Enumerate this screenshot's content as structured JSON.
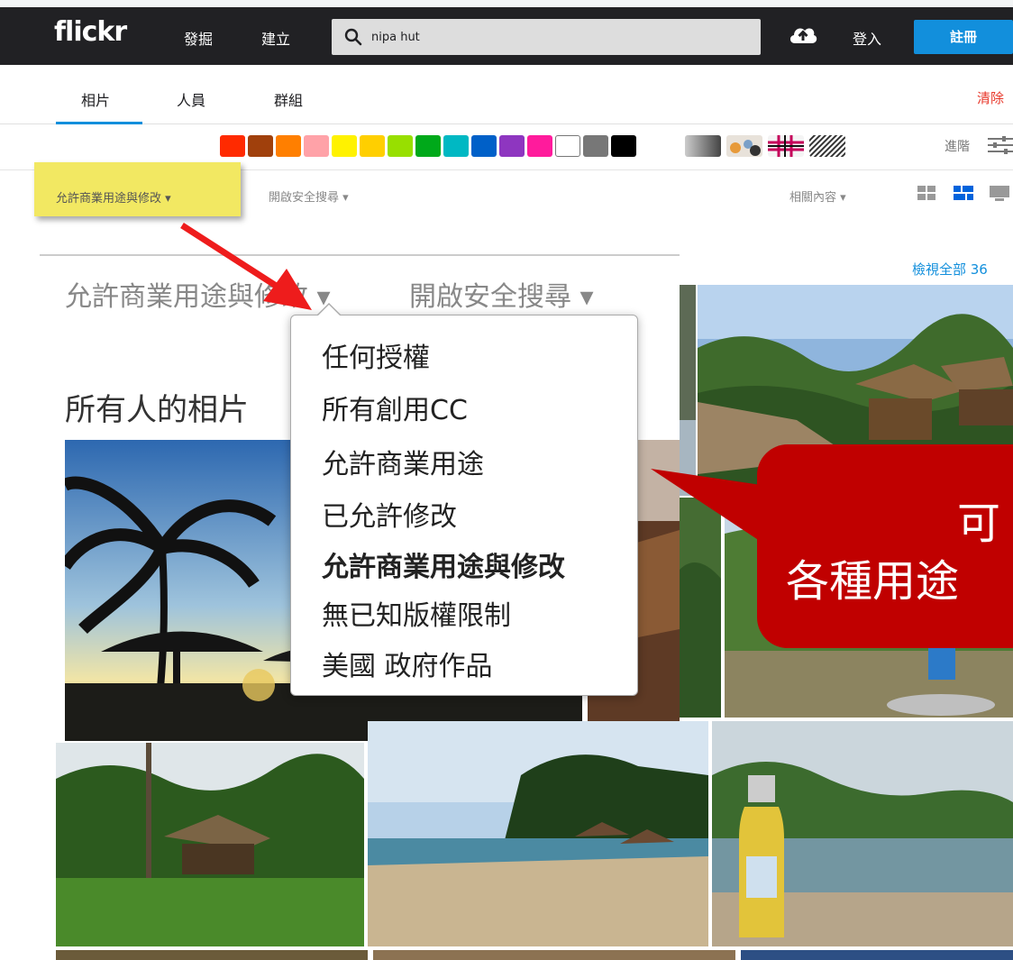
{
  "header": {
    "logo": "flickr",
    "nav": [
      "發掘",
      "建立"
    ],
    "search_value": "nipa hut",
    "login": "登入",
    "signup": "註冊"
  },
  "tabs": {
    "items": [
      "相片",
      "人員",
      "群組"
    ],
    "clear": "清除"
  },
  "colors": {
    "swatches": [
      "#ff2a00",
      "#a0400c",
      "#ff7f00",
      "#ffa2a8",
      "#fff200",
      "#ffcf00",
      "#98df00",
      "#00a91a",
      "#00b8c3",
      "#0060c8",
      "#8e36c0",
      "#ff1b9c",
      "#ffffff",
      "#777777",
      "#000000"
    ],
    "advanced": "進階"
  },
  "filters": {
    "license": "允許商業用途與修改 ▾",
    "safe_search": "開啟安全搜尋 ▾",
    "related": "相關內容 ▾"
  },
  "zoom": {
    "view_all": "檢視全部 36",
    "license_big": "允許商業用途與修改 ▾",
    "safe_big": "開啟安全搜尋 ▾",
    "heading": "所有人的相片"
  },
  "dropdown": {
    "items": [
      "任何授權",
      "所有創用CC",
      "允許商業用途",
      "已允許修改",
      "允許商業用途與修改",
      "無已知版權限制",
      "美國 政府作品"
    ]
  },
  "callout": {
    "line1": "可",
    "line2": "各種用途"
  }
}
